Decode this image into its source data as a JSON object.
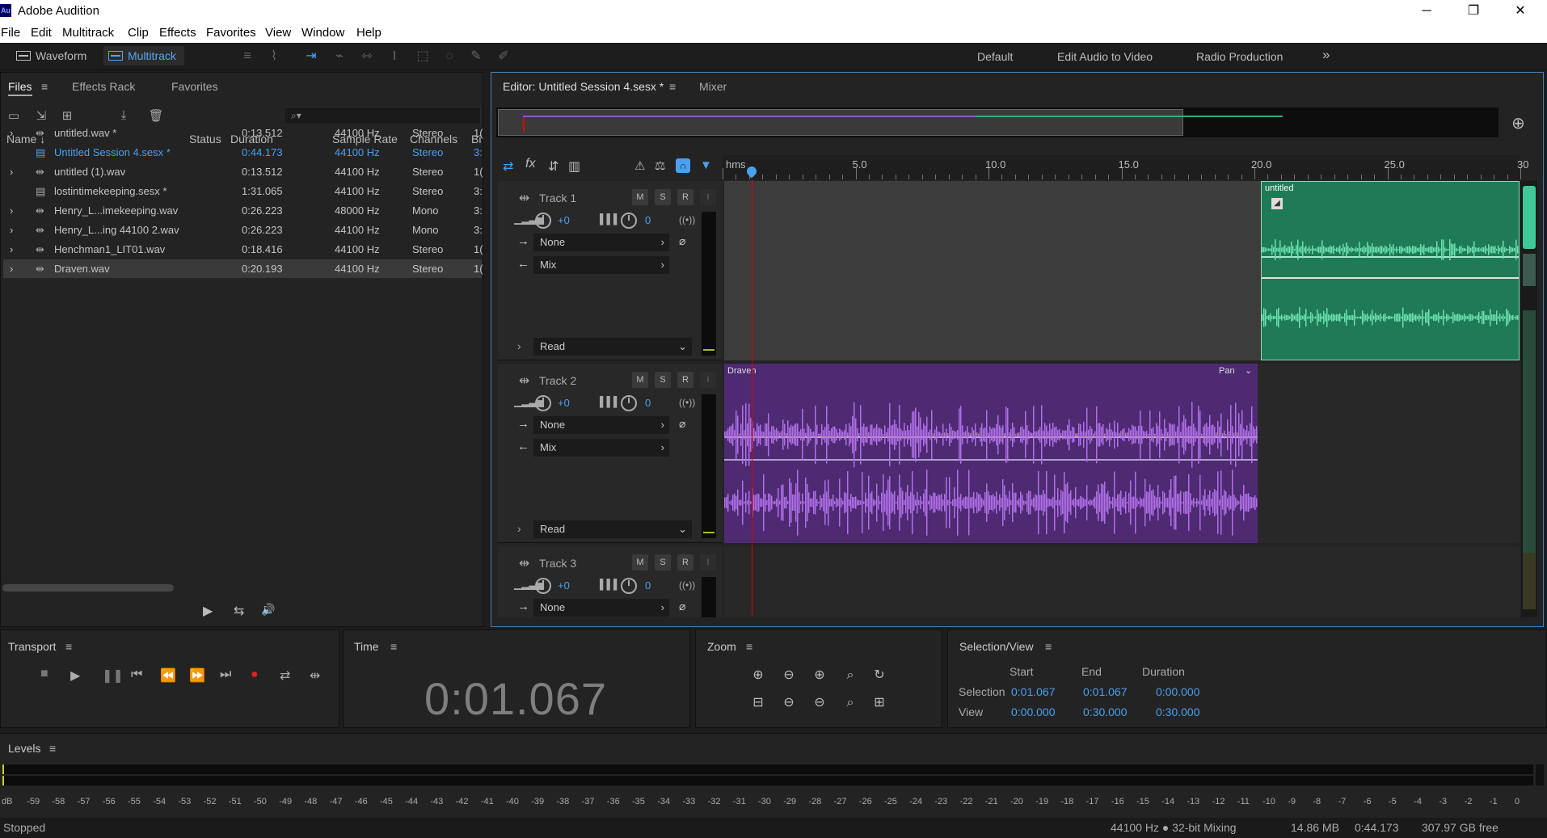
{
  "window": {
    "title": "Adobe Audition",
    "logo_text": "Au",
    "min_label": "─",
    "max_label": "❐",
    "close_label": "✕"
  },
  "menu": [
    "File",
    "Edit",
    "Multitrack",
    "Clip",
    "Effects",
    "Favorites",
    "View",
    "Window",
    "Help"
  ],
  "toolbar": {
    "waveform_label": "Waveform",
    "multitrack_label": "Multitrack",
    "workspaces": [
      "Default",
      "Edit Audio to Video",
      "Radio Production"
    ],
    "more_icon": "»",
    "tool_icons": [
      "≡",
      "⌇",
      "⇥",
      "⌁",
      "⇿",
      "I",
      "⬚",
      "◌",
      "✎",
      "✐"
    ]
  },
  "files_panel": {
    "tabs": [
      "Files",
      "Effects Rack",
      "Favorites"
    ],
    "search_placeholder": "⌕▾",
    "columns": [
      "Name",
      "Status",
      "Duration",
      "Sample Rate",
      "Channels",
      "Bi"
    ],
    "sort_arrow": "↓",
    "rows": [
      {
        "name": "untitled.wav *",
        "duration": "0:13.512",
        "rate": "44100 Hz",
        "channels": "Stereo",
        "bits": "1(",
        "icon": "wave-icon",
        "expand": "›"
      },
      {
        "name": "Untitled Session 4.sesx *",
        "duration": "0:44.173",
        "rate": "44100 Hz",
        "channels": "Stereo",
        "bits": "3:",
        "icon": "session-icon",
        "expand": ""
      },
      {
        "name": "untitled (1).wav",
        "duration": "0:13.512",
        "rate": "44100 Hz",
        "channels": "Stereo",
        "bits": "1(",
        "icon": "wave-icon",
        "expand": "›"
      },
      {
        "name": "lostintimekeeping.sesx *",
        "duration": "1:31.065",
        "rate": "44100 Hz",
        "channels": "Stereo",
        "bits": "3:",
        "icon": "session-icon",
        "expand": ""
      },
      {
        "name": "Henry_L...imekeeping.wav",
        "duration": "0:26.223",
        "rate": "48000 Hz",
        "channels": "Mono",
        "bits": "3:",
        "icon": "wave-icon",
        "expand": "›"
      },
      {
        "name": "Henry_L...ing 44100 2.wav",
        "duration": "0:26.223",
        "rate": "44100 Hz",
        "channels": "Mono",
        "bits": "3:",
        "icon": "wave-icon",
        "expand": "›"
      },
      {
        "name": "Henchman1_LIT01.wav",
        "duration": "0:18.416",
        "rate": "44100 Hz",
        "channels": "Stereo",
        "bits": "1(",
        "icon": "wave-icon",
        "expand": "›"
      },
      {
        "name": "Draven.wav",
        "duration": "0:20.193",
        "rate": "44100 Hz",
        "channels": "Stereo",
        "bits": "1(",
        "icon": "wave-icon",
        "expand": "›"
      }
    ],
    "play_icon": "▶",
    "loop_icon": "⇆",
    "autoplay_icon": "🔊"
  },
  "editor": {
    "tab_label": "Editor: Untitled Session 4.sesx *",
    "mixer_label": "Mixer",
    "ruler_unit": "hms",
    "ruler_labels": [
      "5.0",
      "10.0",
      "15.0",
      "20.0",
      "25.0",
      "30"
    ],
    "tracks": [
      {
        "name": "Track 1",
        "vol": "+0",
        "pan": "0",
        "input": "None",
        "output": "Mix",
        "mode": "Read",
        "color": "#2fb07a"
      },
      {
        "name": "Track 2",
        "vol": "+0",
        "pan": "0",
        "input": "None",
        "output": "Mix",
        "mode": "Read",
        "color": "#7a3fb0"
      },
      {
        "name": "Track 3",
        "vol": "+0",
        "pan": "0",
        "input": "None",
        "color": "#8a7a2a"
      }
    ],
    "track_buttons": [
      "M",
      "S",
      "R"
    ],
    "clip1_label": "untitled",
    "clip2_label": "Draven",
    "clip2_pan": "Pan"
  },
  "transport": {
    "title": "Transport"
  },
  "time": {
    "title": "Time",
    "value": "0:01.067"
  },
  "zoom": {
    "title": "Zoom"
  },
  "selection": {
    "title": "Selection/View",
    "headers": [
      "Start",
      "End",
      "Duration"
    ],
    "selection_label": "Selection",
    "selection": [
      "0:01.067",
      "0:01.067",
      "0:00.000"
    ],
    "view_label": "View",
    "view": [
      "0:00.000",
      "0:30.000",
      "0:30.000"
    ]
  },
  "levels": {
    "title": "Levels",
    "scale": [
      "dB",
      "-59",
      "-58",
      "-57",
      "-56",
      "-55",
      "-54",
      "-53",
      "-52",
      "-51",
      "-50",
      "-49",
      "-48",
      "-47",
      "-46",
      "-45",
      "-44",
      "-43",
      "-42",
      "-41",
      "-40",
      "-39",
      "-38",
      "-37",
      "-36",
      "-35",
      "-34",
      "-33",
      "-32",
      "-31",
      "-30",
      "-29",
      "-28",
      "-27",
      "-26",
      "-25",
      "-24",
      "-23",
      "-22",
      "-21",
      "-20",
      "-19",
      "-18",
      "-17",
      "-16",
      "-15",
      "-14",
      "-13",
      "-12",
      "-11",
      "-10",
      "-9",
      "-8",
      "-7",
      "-6",
      "-5",
      "-4",
      "-3",
      "-2",
      "-1",
      "0"
    ]
  },
  "status": {
    "state": "Stopped",
    "format": "44100 Hz ● 32-bit Mixing",
    "size": "14.86 MB",
    "duration": "0:44.173",
    "free": "307.97 GB free"
  }
}
